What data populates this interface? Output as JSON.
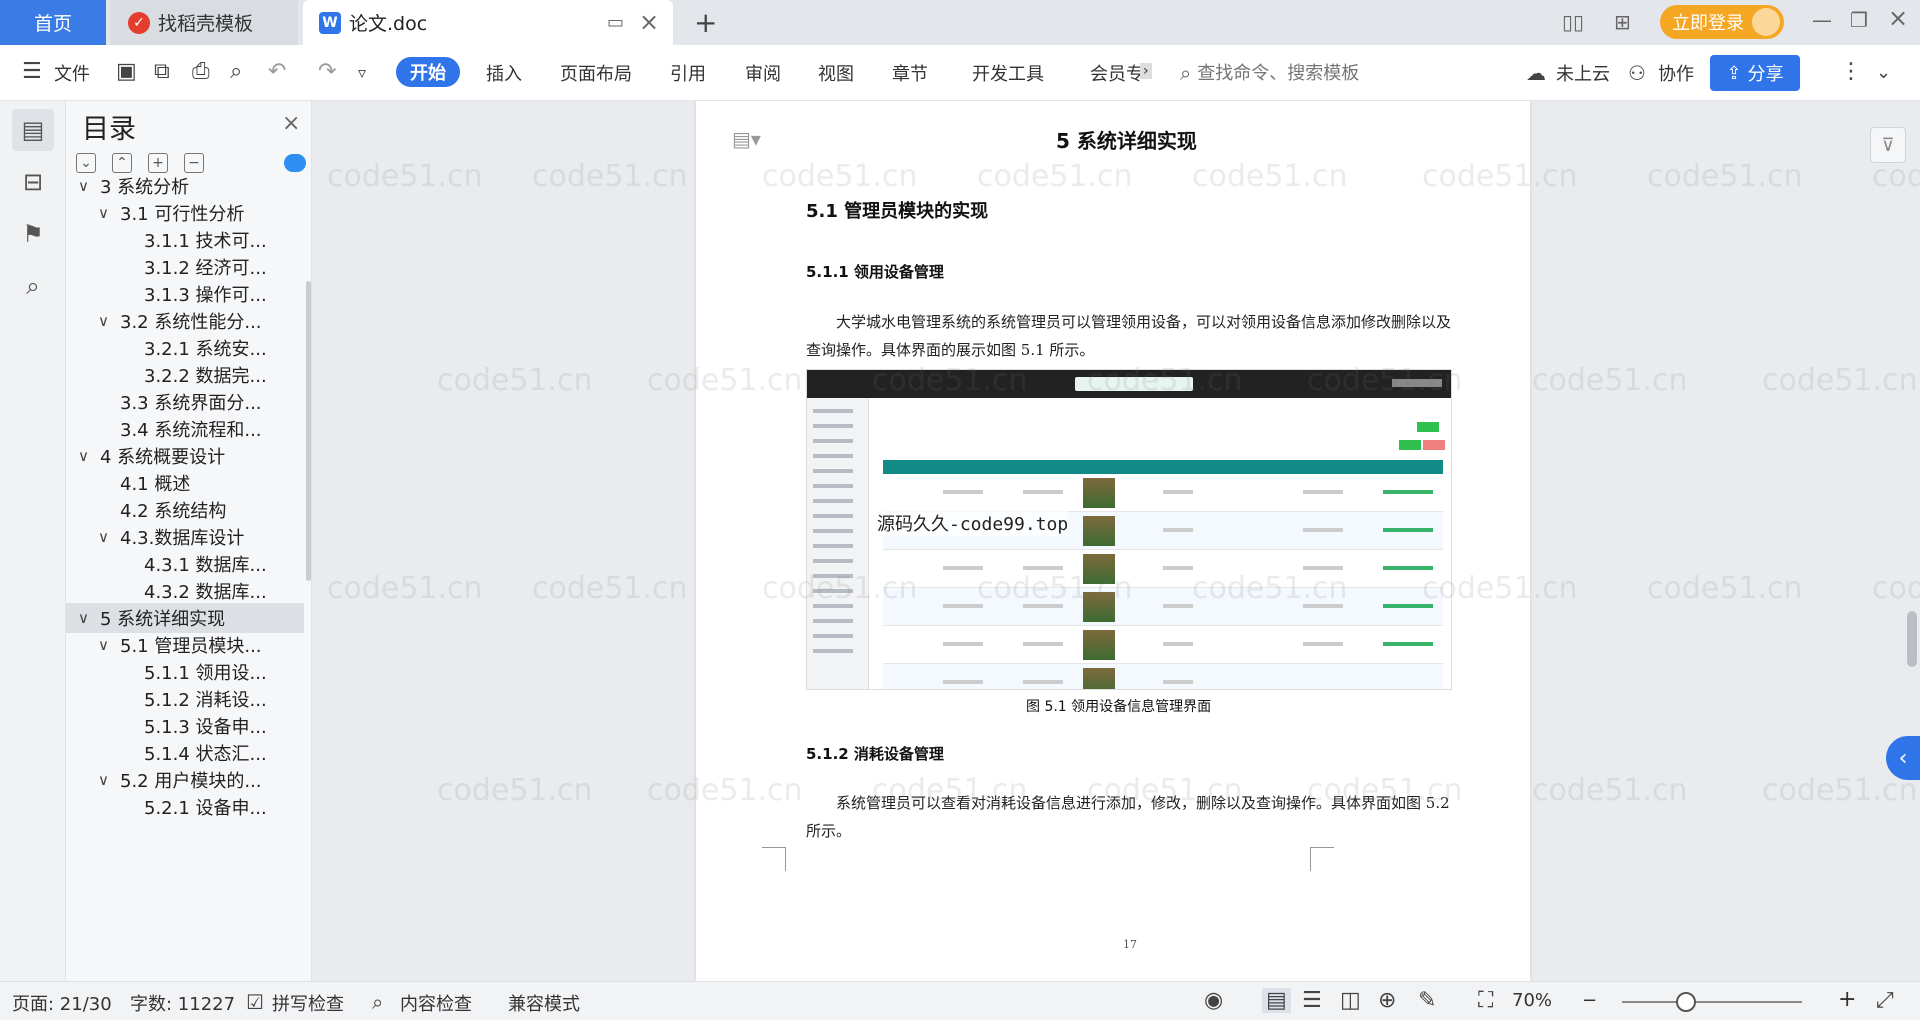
{
  "tabs": {
    "home": "首页",
    "template": "找稻壳模板",
    "doc": "论文.doc"
  },
  "header": {
    "login": "立即登录"
  },
  "toolbar": {
    "file": "文件",
    "menus": [
      "开始",
      "插入",
      "页面布局",
      "引用",
      "审阅",
      "视图",
      "章节",
      "开发工具",
      "会员专"
    ],
    "search_placeholder": "查找命令、搜索模板",
    "cloud": "未上云",
    "collab": "协作",
    "share": "分享"
  },
  "toc": {
    "title": "目录",
    "items": [
      {
        "label": "3 系统分析",
        "level": 0,
        "expand": true
      },
      {
        "label": "3.1 可行性分析",
        "level": 1,
        "expand": true
      },
      {
        "label": "3.1.1 技术可...",
        "level": 2
      },
      {
        "label": "3.1.2 经济可...",
        "level": 2
      },
      {
        "label": "3.1.3 操作可...",
        "level": 2
      },
      {
        "label": "3.2 系统性能分...",
        "level": 1,
        "expand": true
      },
      {
        "label": "3.2.1  系统安...",
        "level": 2
      },
      {
        "label": "3.2.2  数据完...",
        "level": 2
      },
      {
        "label": "3.3 系统界面分...",
        "level": 1
      },
      {
        "label": "3.4 系统流程和...",
        "level": 1
      },
      {
        "label": "4 系统概要设计",
        "level": 0,
        "expand": true
      },
      {
        "label": "4.1 概述",
        "level": 1
      },
      {
        "label": "4.2 系统结构",
        "level": 1
      },
      {
        "label": "4.3.数据库设计",
        "level": 1,
        "expand": true
      },
      {
        "label": "4.3.1 数据库...",
        "level": 2
      },
      {
        "label": "4.3.2 数据库...",
        "level": 2
      },
      {
        "label": "5 系统详细实现",
        "level": 0,
        "expand": true,
        "selected": true
      },
      {
        "label": "5.1  管理员模块...",
        "level": 1,
        "expand": true
      },
      {
        "label": "5.1.1  领用设...",
        "level": 2
      },
      {
        "label": "5.1.2  消耗设...",
        "level": 2
      },
      {
        "label": "5.1.3  设备申...",
        "level": 2
      },
      {
        "label": "5.1.4  状态汇...",
        "level": 2
      },
      {
        "label": "5.2  用户模块的...",
        "level": 1,
        "expand": true
      },
      {
        "label": "5.2.1  设备申...",
        "level": 2
      }
    ]
  },
  "document": {
    "chapter_title": "5 系统详细实现",
    "h2": "5.1  管理员模块的实现",
    "h3_1": "5.1.1  领用设备管理",
    "para1": "大学城水电管理系统的系统管理员可以管理领用设备，可以对领用设备信息添加修改删除以及查询操作。具体界面的展示如图 5.1 所示。",
    "figure_caption": "图 5.1  领用设备信息管理界面",
    "figure_watermark": "源码久久-code99.top",
    "h3_2": "5.1.2  消耗设备管理",
    "para2": "系统管理员可以查看对消耗设备信息进行添加，修改，删除以及查询操作。具体界面如图 5.2 所示。",
    "page_number": "17",
    "watermark": "code51.cn"
  },
  "status": {
    "page": "页面: 21/30",
    "words": "字数: 11227",
    "spell": "拼写检查",
    "content": "内容检查",
    "compat": "兼容模式",
    "zoom": "70%"
  },
  "colors": {
    "accent": "#2f74e8",
    "login": "#f5a623",
    "table_header": "#128a86"
  }
}
